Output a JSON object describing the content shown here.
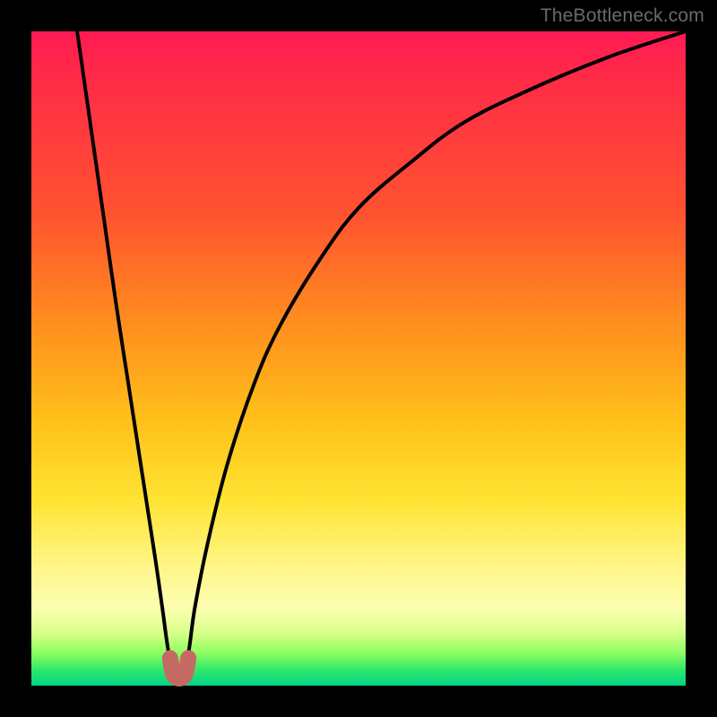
{
  "watermark": "TheBottleneck.com",
  "chart_data": {
    "type": "line",
    "title": "",
    "xlabel": "",
    "ylabel": "",
    "xlim": [
      0,
      100
    ],
    "ylim": [
      0,
      100
    ],
    "grid": false,
    "legend": false,
    "annotations": [],
    "series": [
      {
        "name": "bottleneck-curve",
        "x": [
          7,
          9,
          11,
          13,
          15,
          17,
          19,
          20,
          21,
          22,
          23,
          24,
          25,
          27,
          30,
          34,
          38,
          44,
          50,
          58,
          66,
          76,
          88,
          100
        ],
        "values": [
          100,
          86,
          72,
          58,
          45,
          32,
          19,
          12,
          5,
          2,
          2,
          5,
          12,
          22,
          34,
          46,
          55,
          65,
          73,
          80,
          86,
          91,
          96,
          100
        ]
      },
      {
        "name": "low-point-marker",
        "x": [
          21.2,
          21.6,
          22.2,
          23.0,
          23.6,
          24.0
        ],
        "values": [
          4.2,
          2.0,
          1.2,
          1.2,
          2.0,
          4.2
        ]
      }
    ],
    "colors": {
      "curve": "#000000",
      "marker": "#c56a63"
    }
  }
}
